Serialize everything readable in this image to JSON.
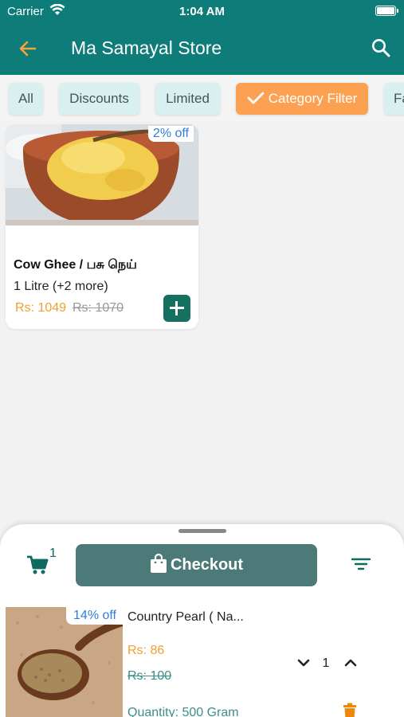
{
  "status": {
    "carrier": "Carrier",
    "time": "1:04 AM"
  },
  "appbar": {
    "title": "Ma Samayal Store"
  },
  "chips": [
    {
      "label": "All"
    },
    {
      "label": "Discounts"
    },
    {
      "label": "Limited"
    },
    {
      "label": "Category Filter",
      "selected": true
    },
    {
      "label": "Fa"
    }
  ],
  "product": {
    "discount": "2% off",
    "name": "Cow Ghee / பசு நெய்",
    "variant": "1 Litre  (+2 more)",
    "price": "Rs: 1049",
    "old_price": "Rs: 1070"
  },
  "cart": {
    "count": "1",
    "checkout_label": "Checkout",
    "item": {
      "discount": "14% off",
      "name": "Country Pearl ( Na...",
      "price": "Rs: 86",
      "old_price": "Rs: 100",
      "quantity": "1",
      "quantity_label": "Quantity: 500 Gram"
    }
  },
  "colors": {
    "primary": "#0e7c78",
    "accent": "#fca052",
    "price": "#f0a030",
    "discount": "#2f7ed8"
  }
}
